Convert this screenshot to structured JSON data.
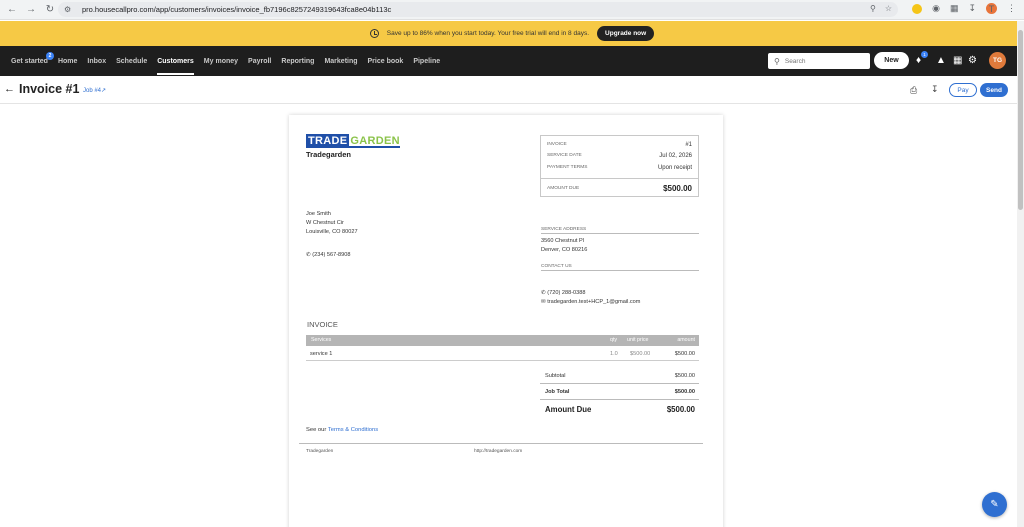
{
  "browser": {
    "url": "pro.housecallpro.com/app/customers/invoices/invoice_fb7196c8257249319643fca8e04b113c",
    "profile_initial": "T"
  },
  "banner": {
    "text": "Save up to 86% when you start today. Your free trial will end in 8 days.",
    "cta": "Upgrade now"
  },
  "nav": {
    "items": [
      {
        "label": "Get started",
        "badge": "2"
      },
      {
        "label": "Home"
      },
      {
        "label": "Inbox"
      },
      {
        "label": "Schedule"
      },
      {
        "label": "Customers",
        "active": true
      },
      {
        "label": "My money"
      },
      {
        "label": "Payroll"
      },
      {
        "label": "Reporting"
      },
      {
        "label": "Marketing"
      },
      {
        "label": "Price book"
      },
      {
        "label": "Pipeline"
      }
    ],
    "search_placeholder": "Search",
    "new_label": "New",
    "notification_count": "1",
    "avatar_initials": "TG"
  },
  "page": {
    "title": "Invoice #1",
    "job_link": "Job #4",
    "pay_label": "Pay",
    "send_label": "Send"
  },
  "invoice": {
    "logo_part1": "TRADE",
    "logo_part2": "GARDEN",
    "company": "Tradegarden",
    "info": {
      "invoice_label": "INVOICE",
      "invoice_value": "#1",
      "service_date_label": "SERVICE DATE",
      "service_date_value": "Jul 02, 2026",
      "payment_terms_label": "PAYMENT TERMS",
      "payment_terms_value": "Upon receipt",
      "amount_due_label": "AMOUNT DUE",
      "amount_due_value": "$500.00"
    },
    "customer": {
      "name": "Joe Smith",
      "street": "W Chestnut Cir",
      "city": "Louisville, CO 80027",
      "phone": "(234) 567-8908"
    },
    "service_address": {
      "label": "SERVICE ADDRESS",
      "line1": "3560 Chestnut Pl",
      "line2": "Denver, CO 80216"
    },
    "contact": {
      "label": "CONTACT US",
      "phone": "(720) 288-0388",
      "email": "tradegarden.test+HCP_1@gmail.com"
    },
    "section_heading": "INVOICE",
    "table": {
      "headers": {
        "services": "Services",
        "qty": "qty",
        "unit_price": "unit price",
        "amount": "amount"
      },
      "rows": [
        {
          "service": "service 1",
          "qty": "1.0",
          "unit_price": "$500.00",
          "amount": "$500.00"
        }
      ]
    },
    "totals": {
      "subtotal_label": "Subtotal",
      "subtotal_value": "$500.00",
      "job_total_label": "Job Total",
      "job_total_value": "$500.00",
      "amount_due_label": "Amount Due",
      "amount_due_value": "$500.00"
    },
    "terms_prefix": "See our",
    "terms_link": "Terms & Conditions",
    "footer_left": "Tradegarden",
    "footer_url": "http://tradegarden.com"
  },
  "colors": {
    "banner": "#f6c945",
    "nav_bg": "#1e1e1e",
    "accent": "#2f6fd1",
    "logo_blue": "#1f4fa8",
    "logo_green": "#8bc34a",
    "avatar": "#e07a3b"
  }
}
